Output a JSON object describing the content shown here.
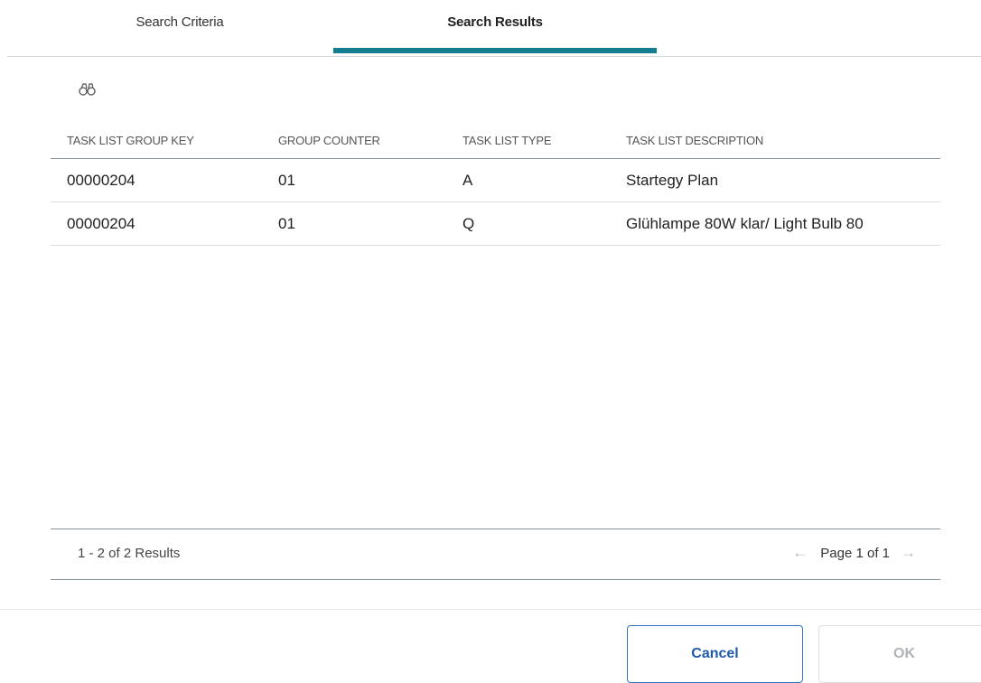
{
  "tabs": [
    {
      "label": "Search Criteria",
      "active": false
    },
    {
      "label": "Search Results",
      "active": true
    }
  ],
  "accent_color": "#147d8f",
  "toolbar": {
    "icon": "binoculars-icon"
  },
  "table": {
    "columns": [
      "TASK LIST GROUP KEY",
      "GROUP COUNTER",
      "TASK LIST TYPE",
      "TASK LIST DESCRIPTION"
    ],
    "rows": [
      [
        "00000204",
        "01",
        "A",
        "Startegy Plan"
      ],
      [
        "00000204",
        "01",
        "Q",
        "Glühlampe 80W klar/ Light Bulb 80"
      ]
    ]
  },
  "footer": {
    "results_text": "1 - 2 of 2 Results",
    "page_text": "Page 1 of 1",
    "prev_icon": "arrow-left-icon",
    "next_icon": "arrow-right-icon"
  },
  "buttons": {
    "cancel": "Cancel",
    "ok": "OK"
  }
}
